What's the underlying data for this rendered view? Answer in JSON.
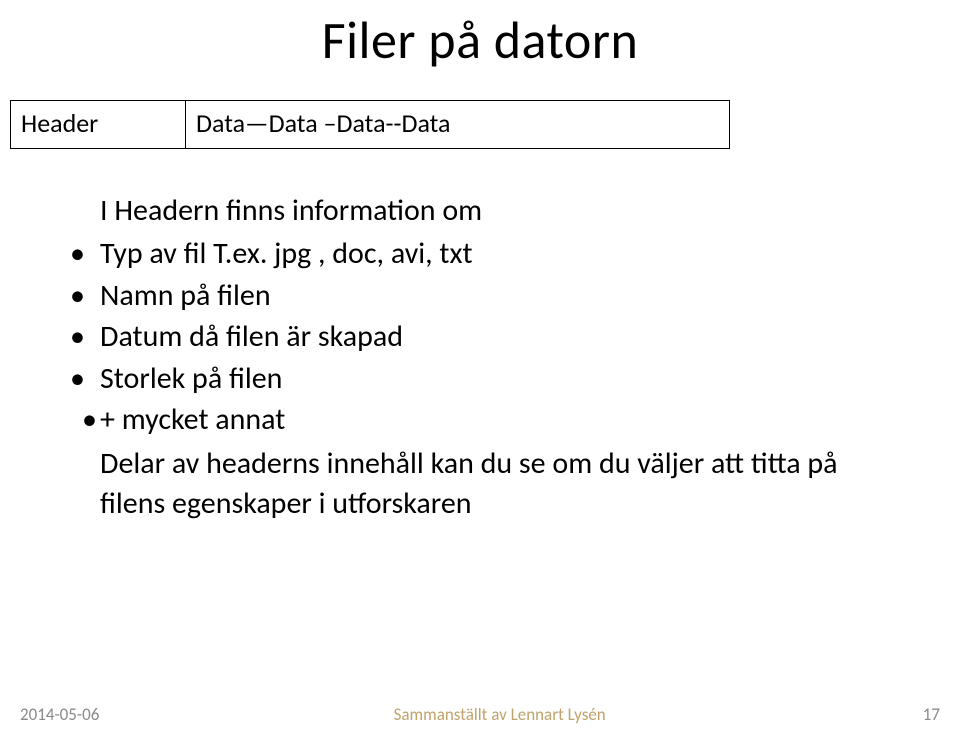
{
  "title": "Filer  på datorn",
  "table": {
    "header": "Header",
    "data": "Data—Data –Data--Data"
  },
  "body": {
    "lead": "I Headern finns information om",
    "bullets": [
      "Typ av fil  T.ex.   jpg , doc, avi, txt",
      "Namn på filen",
      "Datum då filen är skapad",
      "Storlek på filen",
      " + mycket annat"
    ],
    "closing": "Delar av headerns innehåll kan du se om du väljer att titta på filens egenskaper i utforskaren"
  },
  "footer": {
    "date": "2014-05-06",
    "center": "Sammanställt av Lennart Lysén",
    "page": "17"
  }
}
